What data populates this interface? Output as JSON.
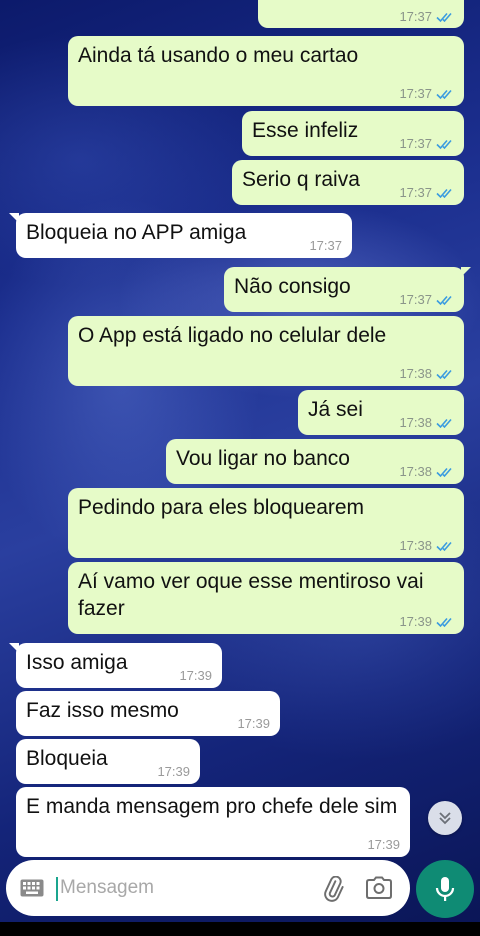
{
  "messages": [
    {
      "dir": "out",
      "text": "17:37",
      "time": "",
      "partial": true
    },
    {
      "dir": "out",
      "text": "Ainda tá usando o meu cartao",
      "time": "17:37"
    },
    {
      "dir": "out",
      "text": "Esse infeliz",
      "time": "17:37"
    },
    {
      "dir": "out",
      "text": "Serio q raiva",
      "time": "17:37"
    },
    {
      "dir": "in",
      "text": "Bloqueia no APP amiga",
      "time": "17:37"
    },
    {
      "dir": "out",
      "text": "Não consigo",
      "time": "17:37"
    },
    {
      "dir": "out",
      "text": "O App está ligado no celular dele",
      "time": "17:38"
    },
    {
      "dir": "out",
      "text": "Já sei",
      "time": "17:38"
    },
    {
      "dir": "out",
      "text": "Vou ligar no banco",
      "time": "17:38"
    },
    {
      "dir": "out",
      "text": "Pedindo para eles bloquearem",
      "time": "17:38"
    },
    {
      "dir": "out",
      "text": "Aí vamo ver oque esse mentiroso vai fazer",
      "time": "17:39"
    },
    {
      "dir": "in",
      "text": "Isso amiga",
      "time": "17:39"
    },
    {
      "dir": "in",
      "text": "Faz isso mesmo",
      "time": "17:39"
    },
    {
      "dir": "in",
      "text": "Bloqueia",
      "time": "17:39"
    },
    {
      "dir": "in",
      "text": "E manda mensagem pro chefe dele sim",
      "time": "17:39"
    }
  ],
  "composer": {
    "placeholder": "Mensagem",
    "keyboard_icon": "keyboard-icon",
    "attach_icon": "paperclip-icon",
    "camera_icon": "camera-icon",
    "mic_icon": "microphone-icon"
  },
  "colors": {
    "outgoing_bubble": "#e6fbc8",
    "incoming_bubble": "#ffffff",
    "read_ticks": "#3a9be0",
    "mic_button": "#0f8b74"
  }
}
